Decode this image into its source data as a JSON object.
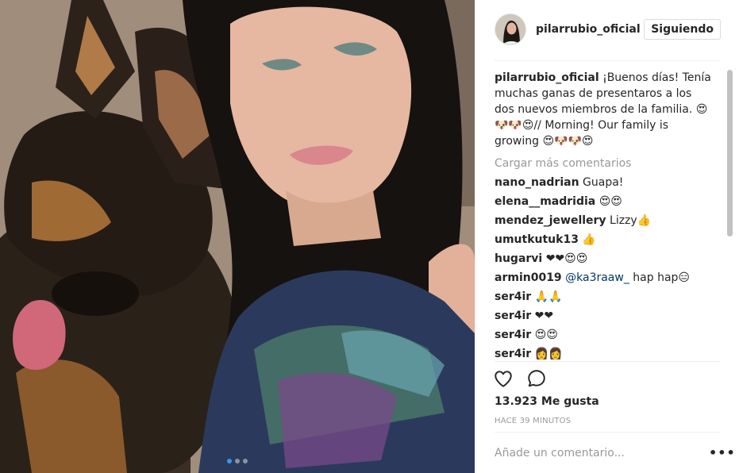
{
  "post": {
    "carousel": {
      "count": 3,
      "active_index": 0
    }
  },
  "header": {
    "username": "pilarrubio_oficial",
    "follow_label": "Siguiendo",
    "verified_icon": "verified-badge-icon"
  },
  "caption": {
    "username": "pilarrubio_oficial",
    "text": "¡Buenos días! Tenía muchas ganas de presentaros a los dos nuevos miembros de la familia. 😍🐶🐶😍// Morning! Our family is growing 😍🐶🐶😍"
  },
  "load_more_label": "Cargar más comentarios",
  "comments": [
    {
      "user": "nano_nadrian",
      "text": "Guapa!"
    },
    {
      "user": "elena__madridia",
      "text": "😍😍"
    },
    {
      "user": "mendez_jewellery",
      "text": "Lizzy👍"
    },
    {
      "user": "umutkutuk13",
      "text": "👍"
    },
    {
      "user": "hugarvi",
      "text": "❤❤😍😍"
    },
    {
      "user": "armin0019",
      "mention": "@ka3raaw_",
      "text": " hap hap😑"
    },
    {
      "user": "ser4ir",
      "text": "🙏🙏"
    },
    {
      "user": "ser4ir",
      "text": "❤❤"
    },
    {
      "user": "ser4ir",
      "text": "😍😍"
    },
    {
      "user": "ser4ir",
      "text": "👩👩"
    }
  ],
  "actions": {
    "like_icon": "heart-icon",
    "comment_icon": "comment-bubble-icon"
  },
  "likes_text": "13.923 Me gusta",
  "time_text": "HACE 39 MINUTOS",
  "add_comment_placeholder": "Añade un comentario...",
  "more_options_label": "•••",
  "colors": {
    "link": "#003569",
    "muted": "#999999",
    "verified": "#3897f0",
    "border": "#efefef"
  }
}
